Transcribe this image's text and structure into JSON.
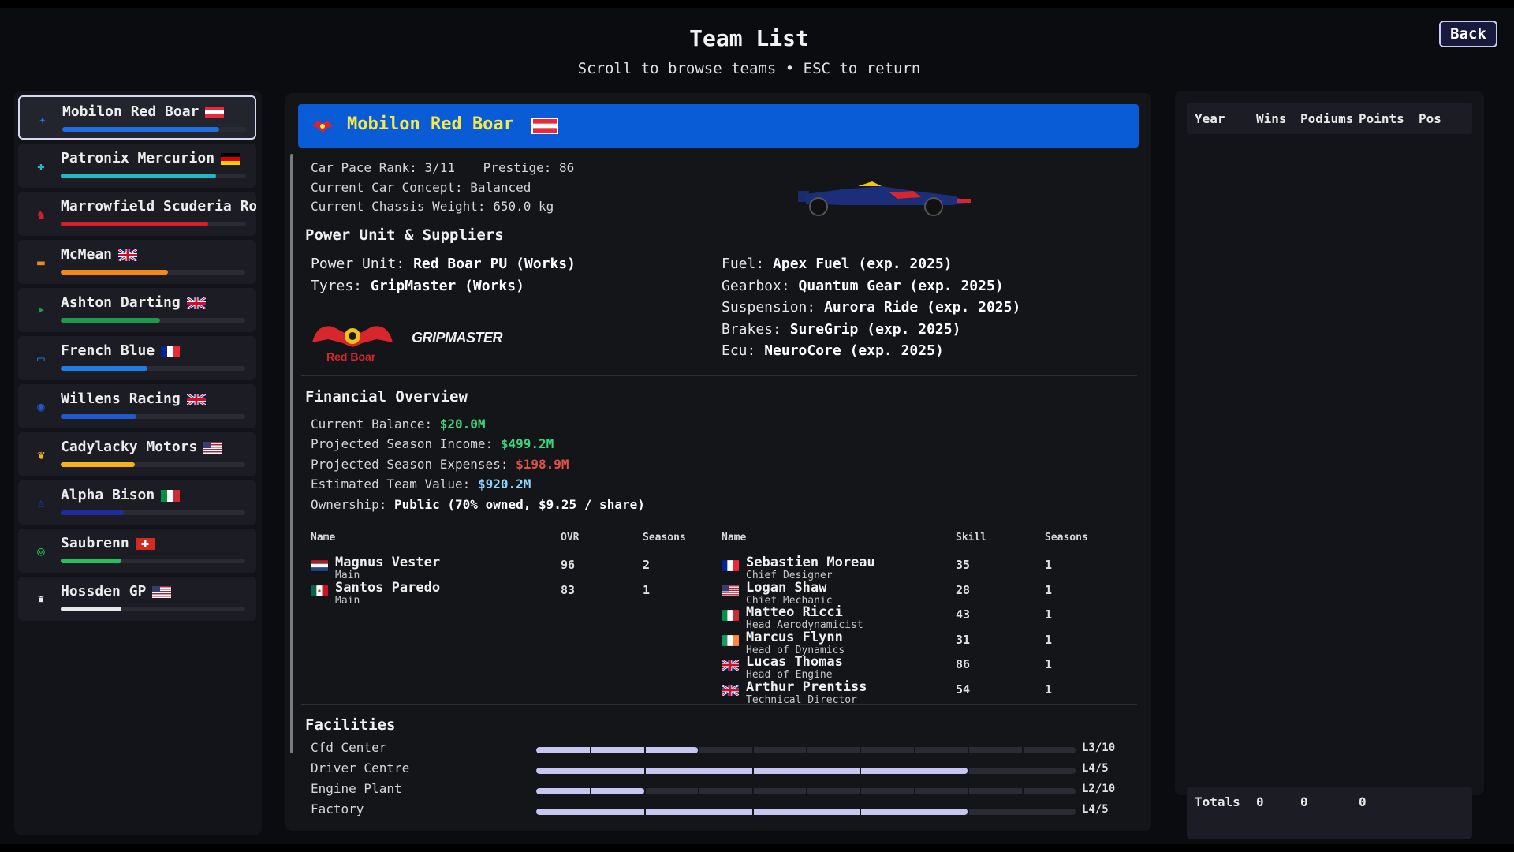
{
  "header": {
    "title": "Team List",
    "subtitle": "Scroll to browse teams • ESC to return",
    "back_label": "Back"
  },
  "sidebar": {
    "teams": [
      {
        "name": "Mobilon Red Boar",
        "flag": "AT",
        "bar": 0.85,
        "color": "#1f6fe0",
        "selected": true
      },
      {
        "name": "Patronix Mercurion",
        "flag": "DE",
        "bar": 0.84,
        "color": "#1fb8c4"
      },
      {
        "name": "Marrowfield Scuderia Ro",
        "flag": "",
        "bar": 0.8,
        "color": "#d61f2d"
      },
      {
        "name": "McMean",
        "flag": "GB",
        "bar": 0.58,
        "color": "#f28a1a"
      },
      {
        "name": "Ashton Darting",
        "flag": "GB",
        "bar": 0.54,
        "color": "#1e9a4e"
      },
      {
        "name": "French Blue",
        "flag": "FR",
        "bar": 0.47,
        "color": "#1e7de6"
      },
      {
        "name": "Willens Racing",
        "flag": "GB",
        "bar": 0.41,
        "color": "#1e5bd0"
      },
      {
        "name": "Cadylacky Motors",
        "flag": "US",
        "bar": 0.4,
        "color": "#f2b418"
      },
      {
        "name": "Alpha Bison",
        "flag": "IT",
        "bar": 0.34,
        "color": "#1f2d9c"
      },
      {
        "name": "Saubrenn",
        "flag": "CH",
        "bar": 0.33,
        "color": "#22c45a"
      },
      {
        "name": "Hossden GP",
        "flag": "US",
        "bar": 0.33,
        "color": "#e8e8e8"
      }
    ]
  },
  "team": {
    "name": "Mobilon Red Boar",
    "pace_rank_label": "Car Pace Rank:",
    "pace_rank": "3/11",
    "prestige_label": "Prestige:",
    "prestige": "86",
    "concept": "Current Car Concept: Balanced",
    "chassis": "Current Chassis Weight: 650.0 kg"
  },
  "power_unit": {
    "heading": "Power Unit & Suppliers",
    "pu_label": "Power Unit:",
    "pu_value": "Red Boar PU (Works)",
    "tyres_label": "Tyres:",
    "tyres_value": "GripMaster (Works)",
    "fuel_label": "Fuel:",
    "fuel_value": "Apex Fuel (exp. 2025)",
    "gearbox_label": "Gearbox:",
    "gearbox_value": "Quantum Gear (exp. 2025)",
    "suspension_label": "Suspension:",
    "suspension_value": "Aurora Ride (exp. 2025)",
    "brakes_label": "Brakes:",
    "brakes_value": "SureGrip (exp. 2025)",
    "ecu_label": "Ecu:",
    "ecu_value": "NeuroCore (exp. 2025)",
    "logo_pu_text": "Red Boar",
    "logo_tyre_text": "GRIPMASTER"
  },
  "finance": {
    "heading": "Financial Overview",
    "balance_label": "Current Balance:",
    "balance": "$20.0M",
    "income_label": "Projected Season Income:",
    "income": "$499.2M",
    "expenses_label": "Projected Season Expenses:",
    "expenses": "$198.9M",
    "value_label": "Estimated Team Value:",
    "value": "$920.2M",
    "ownership_label": "Ownership:",
    "ownership": "Public (70% owned, $9.25 / share)"
  },
  "drivers": {
    "headers": [
      "Name",
      "OVR",
      "Seasons"
    ],
    "rows": [
      {
        "name": "Magnus Vester",
        "role": "Main",
        "ovr": "96",
        "seasons": "2",
        "flag": "NL"
      },
      {
        "name": "Santos Paredo",
        "role": "Main",
        "ovr": "83",
        "seasons": "1",
        "flag": "MX"
      }
    ]
  },
  "staff": {
    "headers": [
      "Name",
      "Skill",
      "Seasons"
    ],
    "rows": [
      {
        "name": "Sebastien Moreau",
        "role": "Chief Designer",
        "skill": "35",
        "seasons": "1",
        "flag": "FR"
      },
      {
        "name": "Logan Shaw",
        "role": "Chief Mechanic",
        "skill": "28",
        "seasons": "1",
        "flag": "US"
      },
      {
        "name": "Matteo Ricci",
        "role": "Head Aerodynamicist",
        "skill": "43",
        "seasons": "1",
        "flag": "IT"
      },
      {
        "name": "Marcus Flynn",
        "role": "Head of Dynamics",
        "skill": "31",
        "seasons": "1",
        "flag": "IE"
      },
      {
        "name": "Lucas Thomas",
        "role": "Head of Engine",
        "skill": "86",
        "seasons": "1",
        "flag": "GB"
      },
      {
        "name": "Arthur Prentiss",
        "role": "Technical Director",
        "skill": "54",
        "seasons": "1",
        "flag": "GB"
      }
    ]
  },
  "facilities": {
    "heading": "Facilities",
    "items": [
      {
        "name": "Cfd Center",
        "level": "L3/10",
        "fraction": 0.3,
        "segments": 10
      },
      {
        "name": "Driver Centre",
        "level": "L4/5",
        "fraction": 0.8,
        "segments": 5
      },
      {
        "name": "Engine Plant",
        "level": "L2/10",
        "fraction": 0.2,
        "segments": 10
      },
      {
        "name": "Factory",
        "level": "L4/5",
        "fraction": 0.8,
        "segments": 5
      }
    ]
  },
  "history": {
    "headers": [
      "Year",
      "Wins",
      "Podiums",
      "Points",
      "Pos"
    ],
    "totals_label": "Totals",
    "totals": [
      "0",
      "0",
      "0"
    ]
  },
  "colors": {
    "banner": "#0a5bd6",
    "team_name": "#f5e94a",
    "money_positive": "#3cd67a",
    "money_negative": "#e4514a",
    "money_value": "#8ad8ff"
  }
}
